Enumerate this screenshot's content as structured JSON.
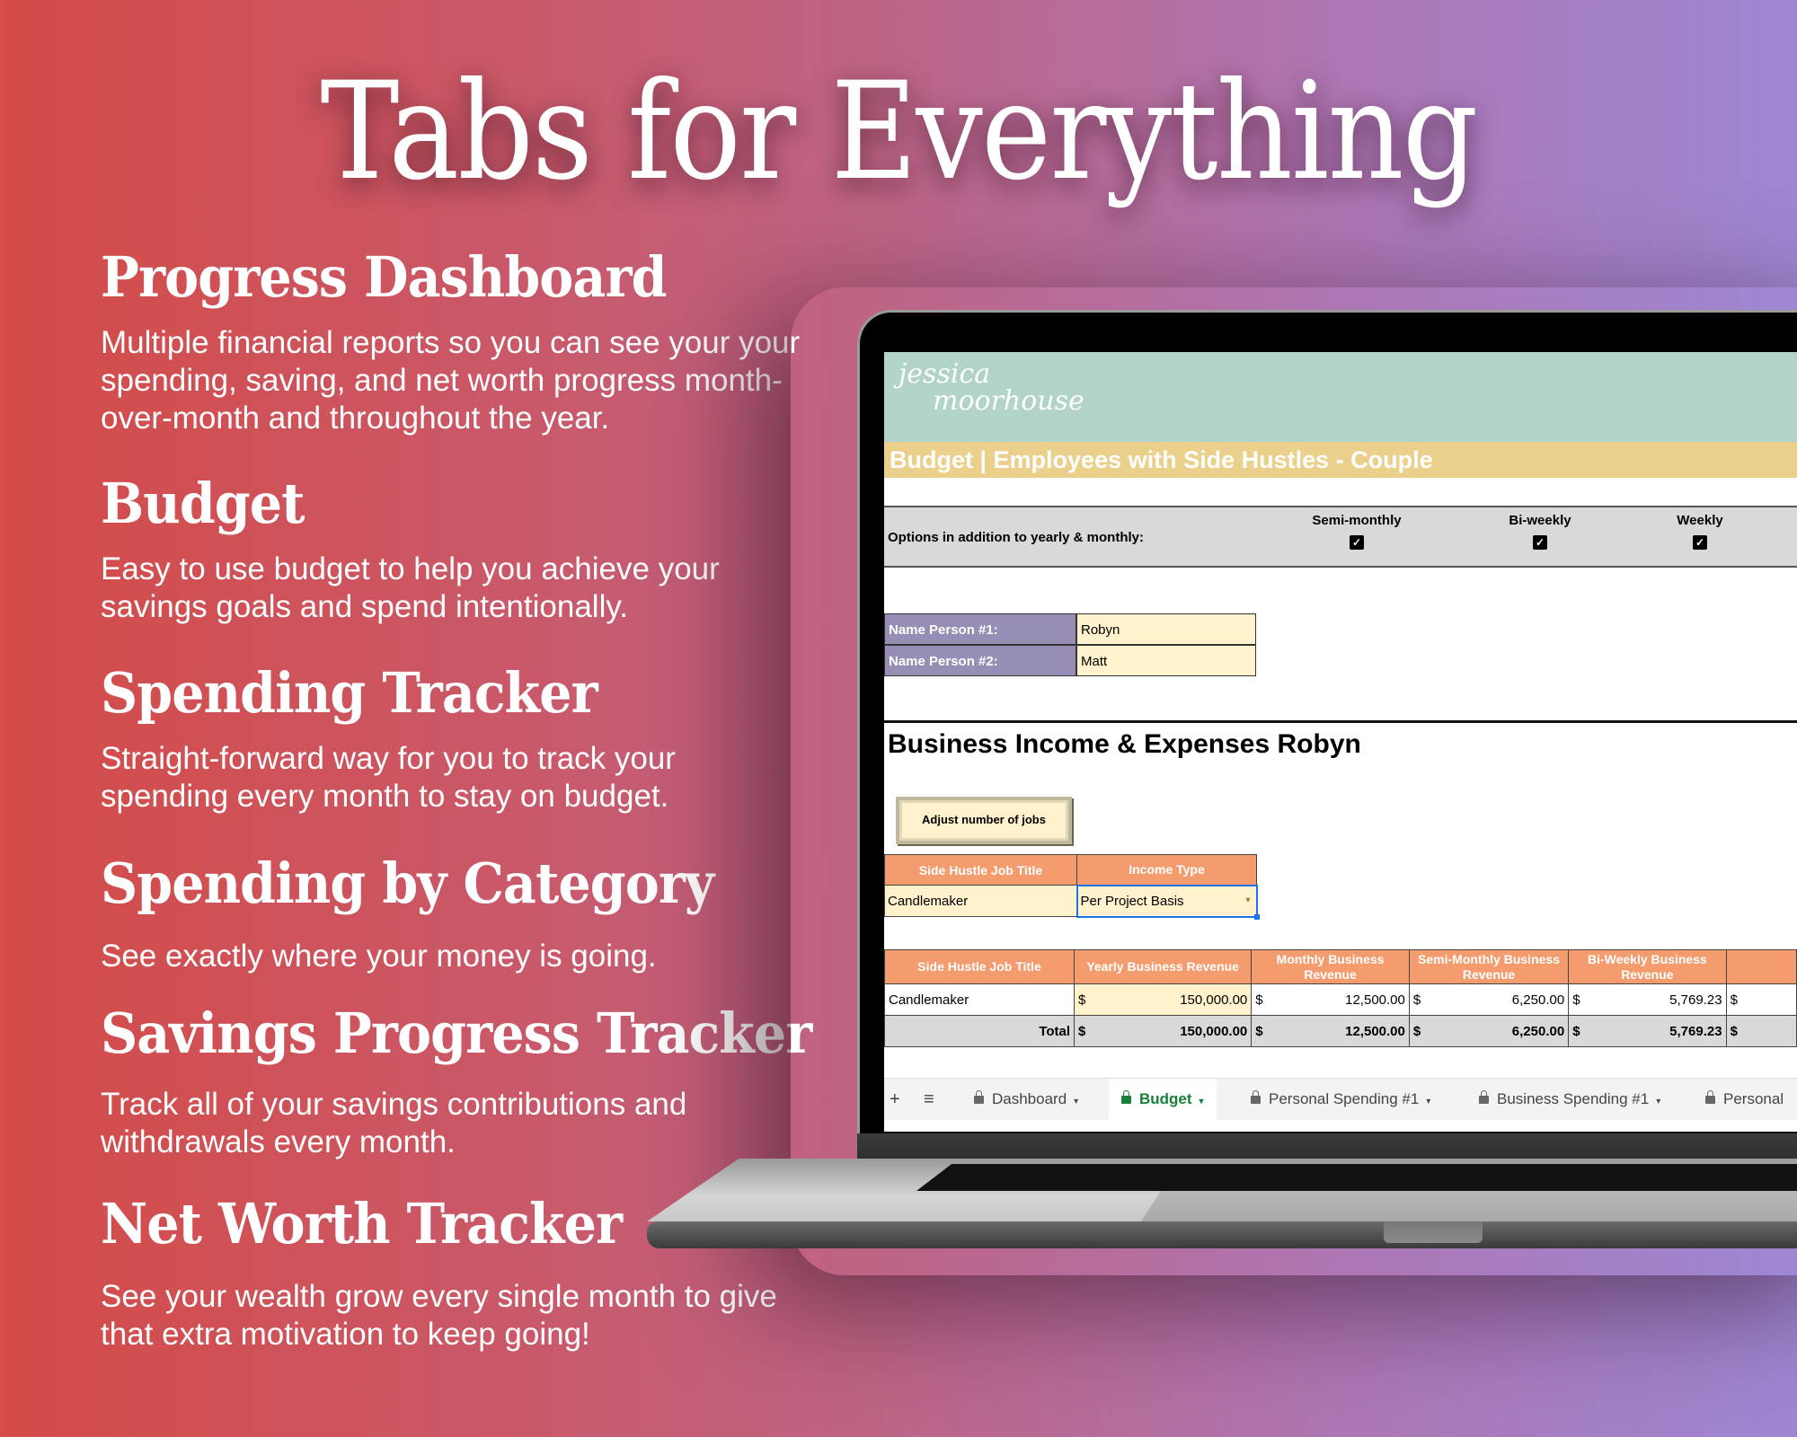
{
  "title": "Tabs for Everything",
  "colors": {
    "gradient_left": "#d44b47",
    "gradient_right": "#9e87d3",
    "header_teal": "#b1d3c8",
    "title_bar_yellow": "#ead08a",
    "table_header_orange": "#f59c6f",
    "name_label_purple": "#978db5",
    "input_cream": "#fff2cc",
    "active_tab_green": "#188038"
  },
  "features": [
    {
      "heading": "Progress Dashboard",
      "text": "Multiple financial reports so you can see your your spending, saving, and net worth progress month-over-month and throughout the year."
    },
    {
      "heading": "Budget",
      "text": "Easy to use budget to help you achieve your savings goals and spend intentionally."
    },
    {
      "heading": "Spending Tracker",
      "text": "Straight-forward way for you to track your spending every month to stay on budget."
    },
    {
      "heading": "Spending by Category",
      "text": "See exactly where your money is going."
    },
    {
      "heading": "Savings Progress Tracker",
      "text": "Track all of your savings contributions and withdrawals every month."
    },
    {
      "heading": "Net Worth Tracker",
      "text": "See your wealth grow every single month to give that extra motivation to keep going!"
    }
  ],
  "sheet": {
    "logo": {
      "line1": "jessica",
      "line2": "moorhouse"
    },
    "title": "Budget | Employees with Side Hustles - Couple",
    "options": {
      "label": "Options in addition to yearly & monthly:",
      "columns": [
        {
          "label": "Semi-monthly",
          "checked": true
        },
        {
          "label": "Bi-weekly",
          "checked": true
        },
        {
          "label": "Weekly",
          "checked": true
        }
      ]
    },
    "names": [
      {
        "label": "Name Person #1:",
        "value": "Robyn"
      },
      {
        "label": "Name Person #2:",
        "value": "Matt"
      }
    ],
    "section_title": "Business Income & Expenses Robyn",
    "adjust_button": "Adjust number of jobs",
    "job_table": {
      "headers": [
        "Side Hustle Job Title",
        "Income Type"
      ],
      "rows": [
        [
          "Candlemaker",
          "Per Project Basis"
        ]
      ]
    },
    "revenue_table": {
      "headers": [
        "Side Hustle Job Title",
        "Yearly Business Revenue",
        "Monthly Business Revenue",
        "Semi-Monthly Business Revenue",
        "Bi-Weekly Business Revenue"
      ],
      "rows": [
        {
          "title": "Candlemaker",
          "values": [
            "150,000.00",
            "12,500.00",
            "6,250.00",
            "5,769.23"
          ]
        }
      ],
      "total": {
        "label": "Total",
        "values": [
          "150,000.00",
          "12,500.00",
          "6,250.00",
          "5,769.23"
        ]
      },
      "currency": "$"
    },
    "tabs": [
      {
        "label": "Dashboard",
        "locked": true,
        "active": false
      },
      {
        "label": "Budget",
        "locked": true,
        "active": true
      },
      {
        "label": "Personal Spending #1",
        "locked": true,
        "active": false
      },
      {
        "label": "Business Spending #1",
        "locked": true,
        "active": false
      },
      {
        "label": "Personal",
        "locked": true,
        "active": false
      }
    ],
    "add_sheet_icon": "+",
    "all_sheets_icon": "≡",
    "check_glyph": "✓",
    "caret_glyph": "▾"
  }
}
